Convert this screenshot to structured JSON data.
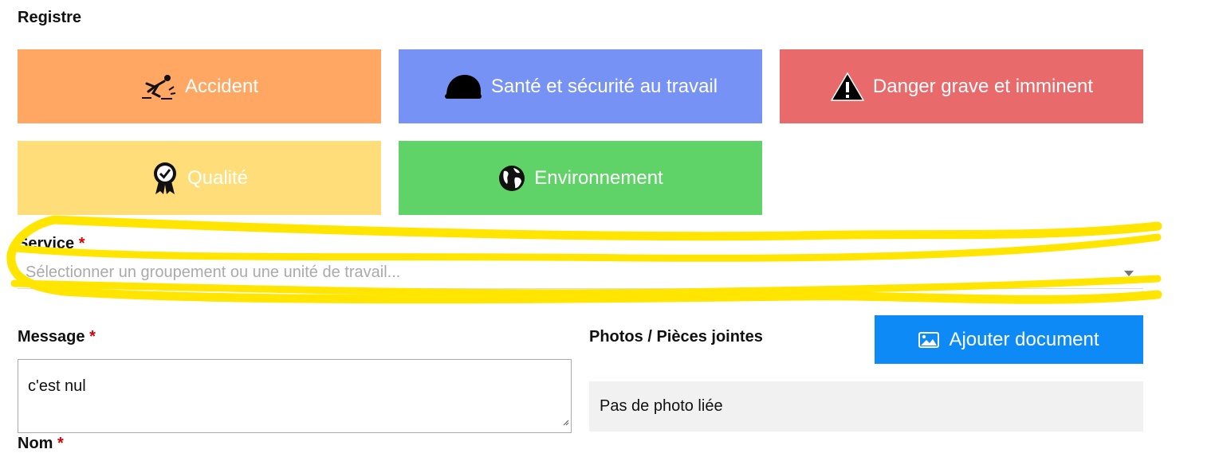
{
  "section": {
    "title": "Registre"
  },
  "categories": [
    {
      "label": "Accident",
      "icon": "person-falling-icon",
      "color": "#ffa763"
    },
    {
      "label": "Santé et sécurité au travail",
      "icon": "hard-hat-icon",
      "color": "#7692f5"
    },
    {
      "label": "Danger grave et imminent",
      "icon": "warning-triangle-icon",
      "color": "#e96a6a"
    },
    {
      "label": "Qualité",
      "icon": "award-ribbon-icon",
      "color": "#ffde79"
    },
    {
      "label": "Environnement",
      "icon": "globe-icon",
      "color": "#5fd368"
    }
  ],
  "service": {
    "label": "Service",
    "required_mark": "*",
    "placeholder": "Sélectionner un groupement ou une unité de travail...",
    "highlight_color": "#ffe500"
  },
  "message": {
    "label": "Message",
    "required_mark": "*",
    "value": "c'est nul"
  },
  "attachments": {
    "label": "Photos / Pièces jointes",
    "add_button": "Ajouter document",
    "add_button_color": "#0d8af5",
    "empty_text": "Pas de photo liée"
  },
  "name": {
    "label": "Nom",
    "required_mark": "*"
  }
}
